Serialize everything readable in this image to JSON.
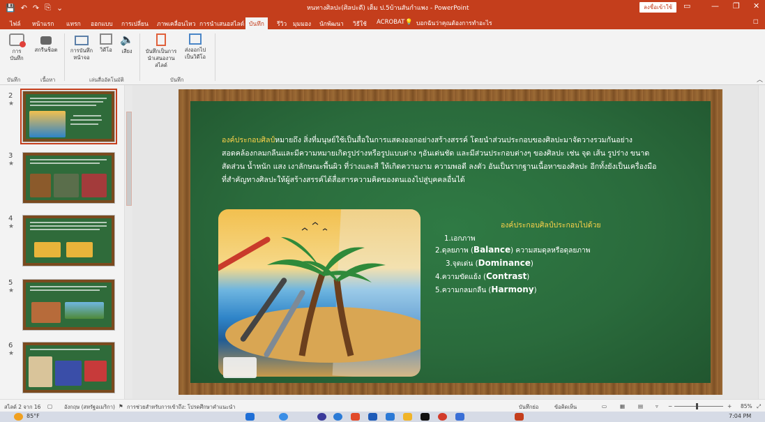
{
  "window": {
    "title": "หนทางศิลปะ(ศิลปะดี) เต็ม ป.5บ้านสันกำแพง - PowerPoint",
    "signin": "ลงชื่อเข้าใช้",
    "controls": [
      "▭",
      "—",
      "❐",
      "✕"
    ],
    "qat": [
      "💾",
      "↶",
      "↷",
      "⎘",
      "⌄"
    ]
  },
  "tabs": {
    "items": [
      "ไฟล์",
      "หน้าแรก",
      "แทรก",
      "ออกแบบ",
      "การเปลี่ยน",
      "ภาพเคลื่อนไหว",
      "การนำเสนอสไลด์",
      "บันทึก",
      "รีวิว",
      "มุมมอง",
      "นักพัฒนา",
      "วิธีใช้",
      "ACROBAT"
    ],
    "active": "บันทึก",
    "tellme": "บอกฉันว่าคุณต้องการทำอะไร"
  },
  "ribbon": {
    "buttons": {
      "record": "การ บันทึก",
      "screenshot": "สกรีนช็อต",
      "screen_record": "การบันทึก หน้าจอ",
      "video": "วิดีโอ",
      "audio": "เสียง",
      "save_show": "บันทึกเป็นการ นำเสนองานสไลด์",
      "export_video": "ส่งออกไป เป็นวิดีโอ"
    },
    "groups": {
      "record": "บันทึก",
      "content": "เนื้อหา",
      "auto_play": "เล่นสื่ออัตโนมัติ",
      "save": "บันทึก"
    }
  },
  "thumbnails": [
    {
      "number": "2",
      "star": "★"
    },
    {
      "number": "3",
      "star": "★"
    },
    {
      "number": "4",
      "star": "★"
    },
    {
      "number": "5",
      "star": "★"
    },
    {
      "number": "6",
      "star": "★"
    }
  ],
  "slide": {
    "paragraph_lead": "องค์ประกอบศิลป์",
    "paragraph_body": "หมายถึง สิ่งที่มนุษย์ใช้เป็นสื่อในการแสดงออกอย่างสร้างสรรค์ โดยนำส่วนประกอบของศิลปะมาจัดวางรวมกันอย่างสอดคล้องกลมกลืนและมีความหมายเกิดรูปร่างหรือรูปแบบต่าง ๆอันเด่นชัด และมีส่วนประกอบต่างๆ ของศิลปะ เช่น จุด เส้น รูปร่าง ขนาด สัดส่วน น้ำหนัก แสง เงาลักษณะพื้นผิว ที่ว่างและสี ให้เกิดความงาม ความพอดี ลงตัว อันเป็นรากฐานเนื้อหาของศิลปะ อีกทั้งยังเป็นเครื่องมือที่สำคัญทางศิลปะให้ผู้สร้างสรรค์ได้สื่อสารความคิดของตนเองไปสู่บุคคลอื่นได้",
    "list_title": "องค์ประกอบศิลป์ประกอบไปด้วย",
    "list": [
      {
        "text": "1.เอกภาพ",
        "en": ""
      },
      {
        "text": "2.ดุลยภาพ (",
        "en": "Balance",
        "suffix": ") ความสมดุลหรือดุลยภาพ"
      },
      {
        "text": "3.จุดเด่น (",
        "en": "Dominance",
        "suffix": ")"
      },
      {
        "text": "4.ความขัดแย้ง (",
        "en": "Contrast",
        "suffix": ")"
      },
      {
        "text": "5.ความกลมกลืน (",
        "en": "Harmony",
        "suffix": ")"
      }
    ]
  },
  "statusbar": {
    "slide_count": "สไลด์ 2 จาก 16",
    "language": "อังกฤษ (สหรัฐอเมริกา)",
    "accessibility": "การช่วยสำหรับการเข้าถึง: โปรดศึกษาคำแนะนำ",
    "notes": "บันทึกย่อ",
    "comments": "ข้อคิดเห็น",
    "zoom": "85%",
    "zoom_minus": "−",
    "zoom_plus": "+"
  },
  "taskbar": {
    "weather": "85°F",
    "time": "7:04 PM"
  },
  "colors": {
    "accent": "#c43e1c",
    "board": "#2a6b3c",
    "highlight": "#ffd44a"
  }
}
